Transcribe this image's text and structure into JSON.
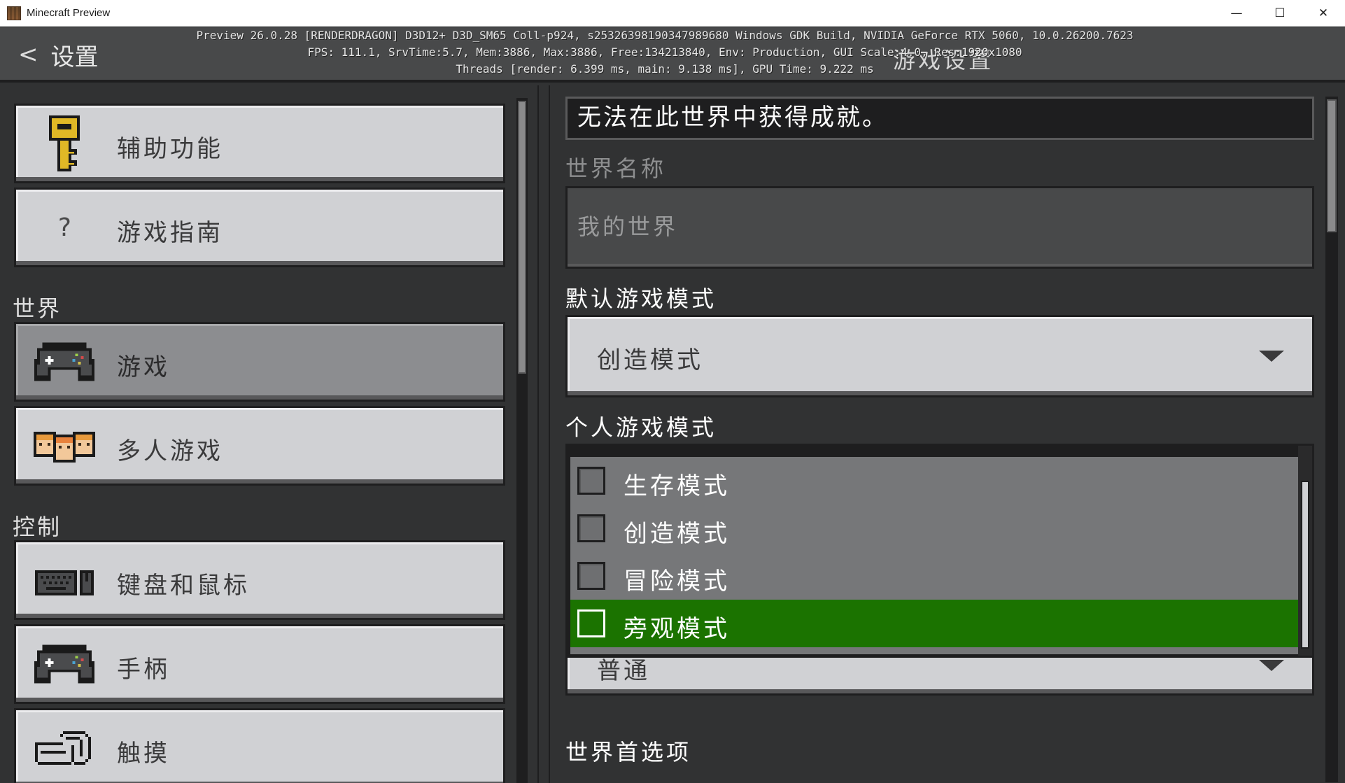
{
  "window": {
    "title": "Minecraft Preview",
    "minimize_glyph": "—",
    "maximize_glyph": "☐",
    "close_glyph": "✕"
  },
  "header": {
    "back_label": "设置",
    "title": "游戏设置",
    "debug_lines": [
      "Preview 26.0.28 [RENDERDRAGON] D3D12+ D3D_SM65 Coll-p924, s25326398190347989680 Windows GDK Build, NVIDIA GeForce RTX 5060, 10.0.26200.7623",
      "FPS: 111.1, SrvTime:5.7, Mem:3886, Max:3886, Free:134213840, Env: Production, GUI Scale:4.0, Res:1920x1080",
      "Threads [render: 6.399 ms, main: 9.138 ms], GPU Time: 9.222 ms"
    ]
  },
  "sidebar": {
    "sections": [
      {
        "label": null,
        "items": [
          {
            "label": "辅助功能",
            "icon": "key-icon"
          },
          {
            "label": "游戏指南",
            "icon": "question-icon"
          }
        ]
      },
      {
        "label": "世界",
        "items": [
          {
            "label": "游戏",
            "icon": "controller-icon",
            "selected": true
          },
          {
            "label": "多人游戏",
            "icon": "players-icon"
          }
        ]
      },
      {
        "label": "控制",
        "items": [
          {
            "label": "键盘和鼠标",
            "icon": "keyboard-mouse-icon"
          },
          {
            "label": "手柄",
            "icon": "gamepad-icon"
          },
          {
            "label": "触摸",
            "icon": "touch-icon"
          }
        ]
      }
    ]
  },
  "main": {
    "achievements_notice": "无法在此世界中获得成就。",
    "world_name": {
      "label": "世界名称",
      "value": "我的世界"
    },
    "default_game_mode": {
      "label": "默认游戏模式",
      "value": "创造模式"
    },
    "personal_game_mode": {
      "label": "个人游戏模式",
      "options": [
        "生存模式",
        "创造模式",
        "冒险模式",
        "旁观模式"
      ],
      "highlighted": "旁观模式"
    },
    "difficulty": {
      "value": "普通"
    },
    "world_preferences": {
      "label": "世界首选项"
    }
  },
  "colors": {
    "panel_bg": "#313233",
    "header_bg": "#48494a",
    "button_bg": "#d0d1d4",
    "button_selected_bg": "#8c8d90",
    "highlight_green": "#1b7300"
  }
}
